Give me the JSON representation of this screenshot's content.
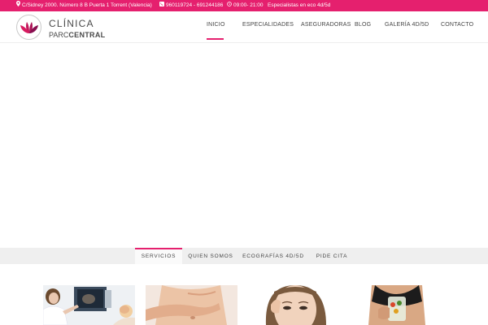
{
  "topbar": {
    "address": "C/Sidney 2000. Número 8 B Puerta 1 Torrent (Valencia)",
    "phones": "960119724 - 691244186",
    "hours": "09:00- 21:00",
    "tagline": "Especialistas en eco 4d/5d",
    "icons": [
      "map-marker-icon",
      "phone-icon",
      "clock-icon"
    ]
  },
  "logo": {
    "line1": "CLÍNICA",
    "line2_a": "PARC",
    "line2_b": "CENTRAL",
    "icon": "lotus-icon"
  },
  "nav": {
    "items": [
      {
        "label": "INICIO",
        "active": true
      },
      {
        "label": "ESPECIALIDADES"
      },
      {
        "label": "ASEGURADORAS"
      },
      {
        "label": "BLOG"
      },
      {
        "label": "GALERÍA 4D/5D"
      },
      {
        "label": "CONTACTO"
      }
    ]
  },
  "tabs": {
    "items": [
      {
        "label": "SERVICIOS",
        "active": true
      },
      {
        "label": "QUIEN SOMOS"
      },
      {
        "label": "ECOGRAFÍAS 4D/5D"
      },
      {
        "label": "PIDE CITA"
      }
    ]
  },
  "colors": {
    "brand": "#e5206e",
    "tab_bar": "#efefef",
    "text": "#444444"
  },
  "photos": [
    "ultrasound-photo",
    "belly-photo",
    "face-photo",
    "fitness-photo"
  ]
}
